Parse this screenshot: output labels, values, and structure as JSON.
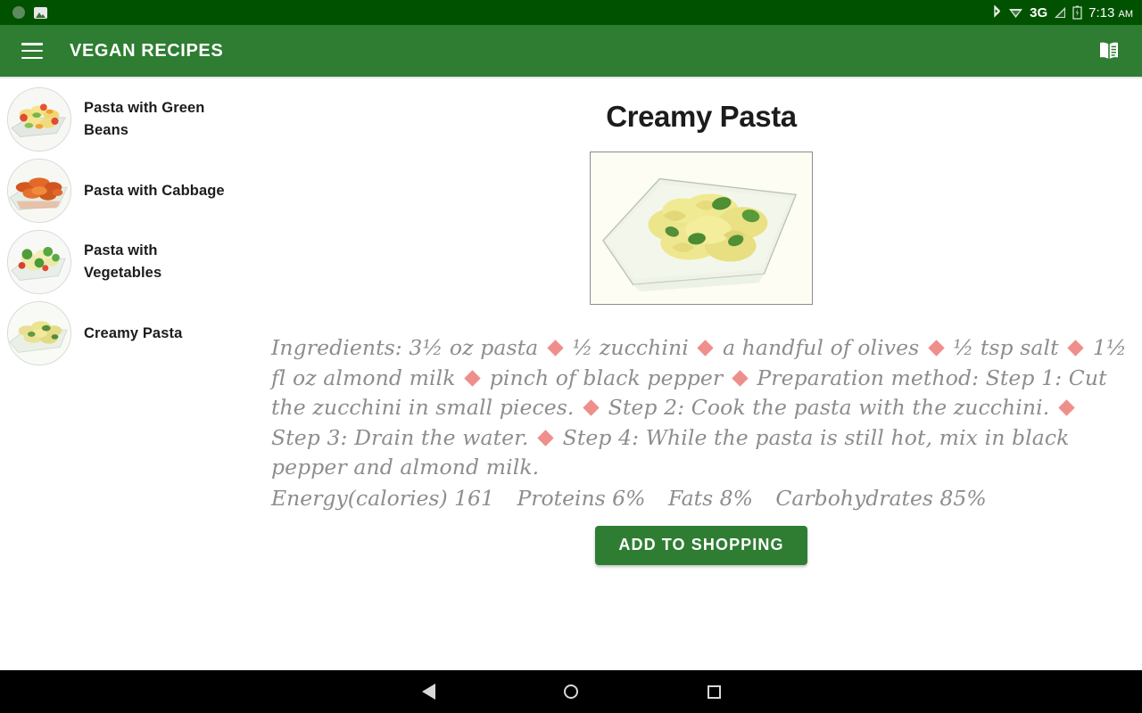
{
  "statusbar": {
    "left_icons": [
      "circle-placeholder-icon",
      "image-icon"
    ],
    "bluetooth_glyph": "✳",
    "network_label": "3G",
    "time": "7:13",
    "meridiem": "AM"
  },
  "appbar": {
    "menu_icon": "hamburger-menu-icon",
    "title": "VEGAN RECIPES",
    "book_icon": "menu-book-icon",
    "background": "#2e7d32"
  },
  "sidebar": {
    "items": [
      {
        "label": "Pasta with Green Beans",
        "thumb": "pasta-green-beans-thumb"
      },
      {
        "label": "Pasta with Cabbage",
        "thumb": "pasta-cabbage-thumb"
      },
      {
        "label": "Pasta with Vegetables",
        "thumb": "pasta-vegetables-thumb"
      },
      {
        "label": "Creamy Pasta",
        "thumb": "creamy-pasta-thumb"
      }
    ]
  },
  "recipe": {
    "title": "Creamy Pasta",
    "photo": "creamy-pasta-photo",
    "ingredients_label": "Ingredients:",
    "ingredients": [
      "3½ oz pasta",
      "½ zucchini",
      "a handful of olives",
      "½ tsp salt",
      "1½ fl oz almond milk",
      "pinch of black pepper"
    ],
    "preparation_label": "Preparation method:",
    "steps": [
      "Step 1: Cut the zucchini in small pieces.",
      "Step 2: Cook the pasta with the zucchini.",
      "Step 3: Drain the water.",
      "Step 4: While the pasta is still hot, mix in black pepper and almond milk."
    ],
    "nutrition": {
      "energy": "Energy(calories) 161",
      "proteins": "Proteins 6%",
      "fats": "Fats 8%",
      "carbohydrates": "Carbohydrates 85%"
    },
    "add_button": "ADD TO SHOPPING",
    "separator_color": "#ef8f8b",
    "body_text_color": "#8d8d8d"
  },
  "navbar": {
    "back": "back-nav-icon",
    "home": "home-nav-icon",
    "recents": "recents-nav-icon"
  }
}
